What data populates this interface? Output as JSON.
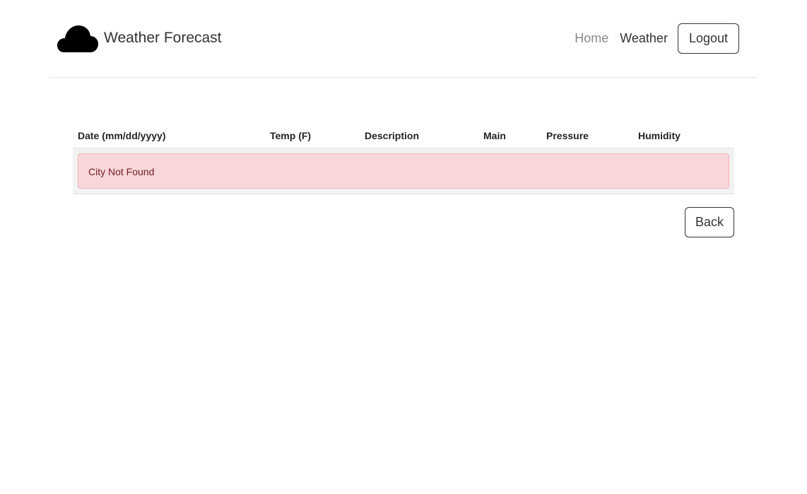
{
  "header": {
    "logo_icon": "cloud-icon",
    "title": "Weather Forecast",
    "nav": {
      "home_label": "Home",
      "weather_label": "Weather",
      "logout_label": "Logout"
    }
  },
  "table": {
    "columns": [
      "Date (mm/dd/yyyy)",
      "Temp (F)",
      "Description",
      "Main",
      "Pressure",
      "Humidity"
    ],
    "error_message": "City Not Found"
  },
  "actions": {
    "back_label": "Back"
  },
  "colors": {
    "alert_bg": "#f8d7da",
    "alert_text": "#721c24",
    "row_bg": "#f2f2f2"
  }
}
